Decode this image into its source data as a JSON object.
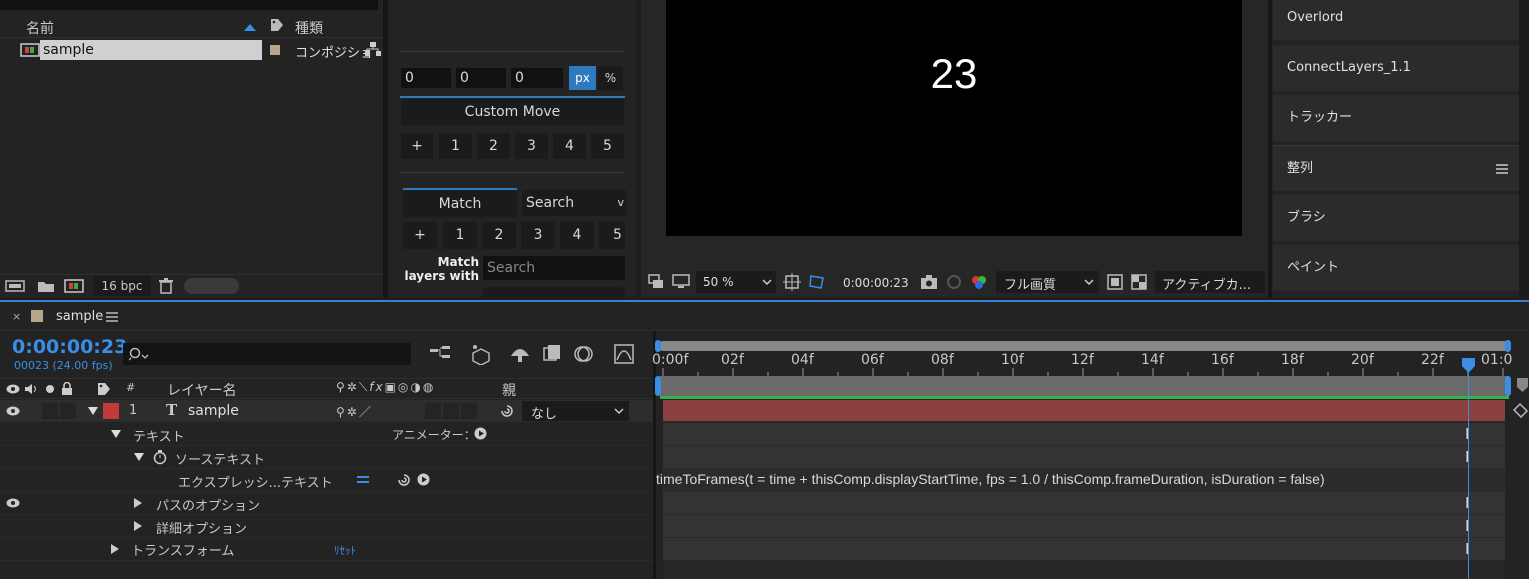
{
  "project": {
    "col_name": "名前",
    "col_type": "種類",
    "item_name": "sample",
    "item_type": "コンポジショ",
    "bpc": "16 bpc"
  },
  "plugin": {
    "fields": [
      "0",
      "0",
      "0"
    ],
    "unit_px": "px",
    "unit_pct": "%",
    "custom_move": "Custom Move",
    "row1": [
      "+",
      "1",
      "2",
      "3",
      "4",
      "5"
    ],
    "tab_match": "Match",
    "search_btn": "Search",
    "row2": [
      "+",
      "1",
      "2",
      "3",
      "4",
      "5"
    ],
    "match_layers_label": "Match layers with",
    "search_placeholder": "Search"
  },
  "viewer": {
    "frame_text": "23",
    "zoom": "50 %",
    "timecode": "0:00:00:23",
    "quality": "フル画質",
    "view": "アクティブカ..."
  },
  "right_panel": {
    "items": [
      "Overlord",
      "ConnectLayers_1.1",
      "トラッカー",
      "整列",
      "ブラシ",
      "ペイント"
    ]
  },
  "timeline": {
    "tab_name": "sample",
    "timecode": "0:00:00:23",
    "frames_fps": "00023 (24.00 fps)",
    "search_placeholder": "",
    "col_num": "#",
    "col_layer_name": "レイヤー名",
    "col_parent": "親",
    "ruler": [
      "0:00f",
      "02f",
      "04f",
      "06f",
      "08f",
      "10f",
      "12f",
      "14f",
      "16f",
      "18f",
      "20f",
      "22f",
      "01:0"
    ],
    "layer": {
      "num": "1",
      "name": "sample",
      "parent": "なし"
    },
    "rows": {
      "text": "テキスト",
      "animator": "アニメーター：",
      "source_text": "ソーステキスト",
      "expression": "エクスプレッシ...テキスト",
      "path_options": "パスのオプション",
      "more_options": "詳細オプション",
      "transform": "トランスフォーム",
      "reset": "ﾘｾｯﾄ"
    },
    "expression_code": "timeToFrames(t = time + thisComp.displayStartTime, fps = 1.0 / thisComp.frameDuration, isDuration = false)"
  },
  "colors": {
    "accent": "#3a8ee6",
    "label_red": "#c13b3b",
    "layer_bar": "#8c3f3f",
    "work_green": "#37b24d"
  }
}
